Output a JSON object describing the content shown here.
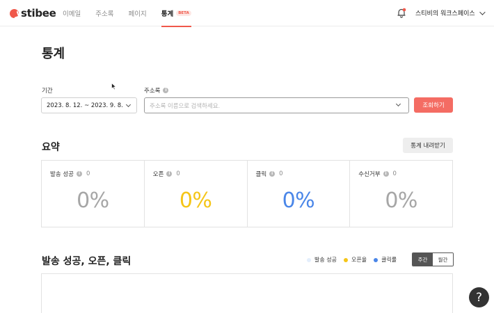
{
  "app": {
    "logo_text": "stibee",
    "brand_color": "#f0584a"
  },
  "nav": {
    "items": [
      {
        "label": "이메일",
        "active": false
      },
      {
        "label": "주소록",
        "active": false
      },
      {
        "label": "페이지",
        "active": false
      },
      {
        "label": "통계",
        "active": true,
        "badge": "BETA"
      }
    ]
  },
  "header": {
    "notification_icon": "bell-icon",
    "workspace_name": "스티비의 워크스페이스"
  },
  "page": {
    "title": "통계"
  },
  "filters": {
    "period_label": "기간",
    "period_value": "2023. 8. 12. ~ 2023. 9. 8.",
    "addressbook_label": "주소록",
    "addressbook_placeholder": "주소록 이름으로 검색하세요.",
    "search_button": "조회하기"
  },
  "summary": {
    "title": "요약",
    "download_button": "통계 내려받기",
    "cards": [
      {
        "label": "발송 성공",
        "count": "0",
        "percent": "0%",
        "color": "#a6a6a6"
      },
      {
        "label": "오픈",
        "count": "0",
        "percent": "0%",
        "color": "#f5c518"
      },
      {
        "label": "클릭",
        "count": "0",
        "percent": "0%",
        "color": "#4a86e8"
      },
      {
        "label": "수신거부",
        "count": "0",
        "percent": "0%",
        "color": "#a6a6a6"
      }
    ]
  },
  "chart_section": {
    "title": "발송 성공, 오픈, 클릭",
    "legend": [
      {
        "label": "발송 성공",
        "color": "#e3eefc"
      },
      {
        "label": "오픈율",
        "color": "#f5c518"
      },
      {
        "label": "클릭률",
        "color": "#4a86e8"
      }
    ],
    "toggle": [
      {
        "label": "주간",
        "active": true
      },
      {
        "label": "월간",
        "active": false
      }
    ]
  },
  "help_button": "?"
}
